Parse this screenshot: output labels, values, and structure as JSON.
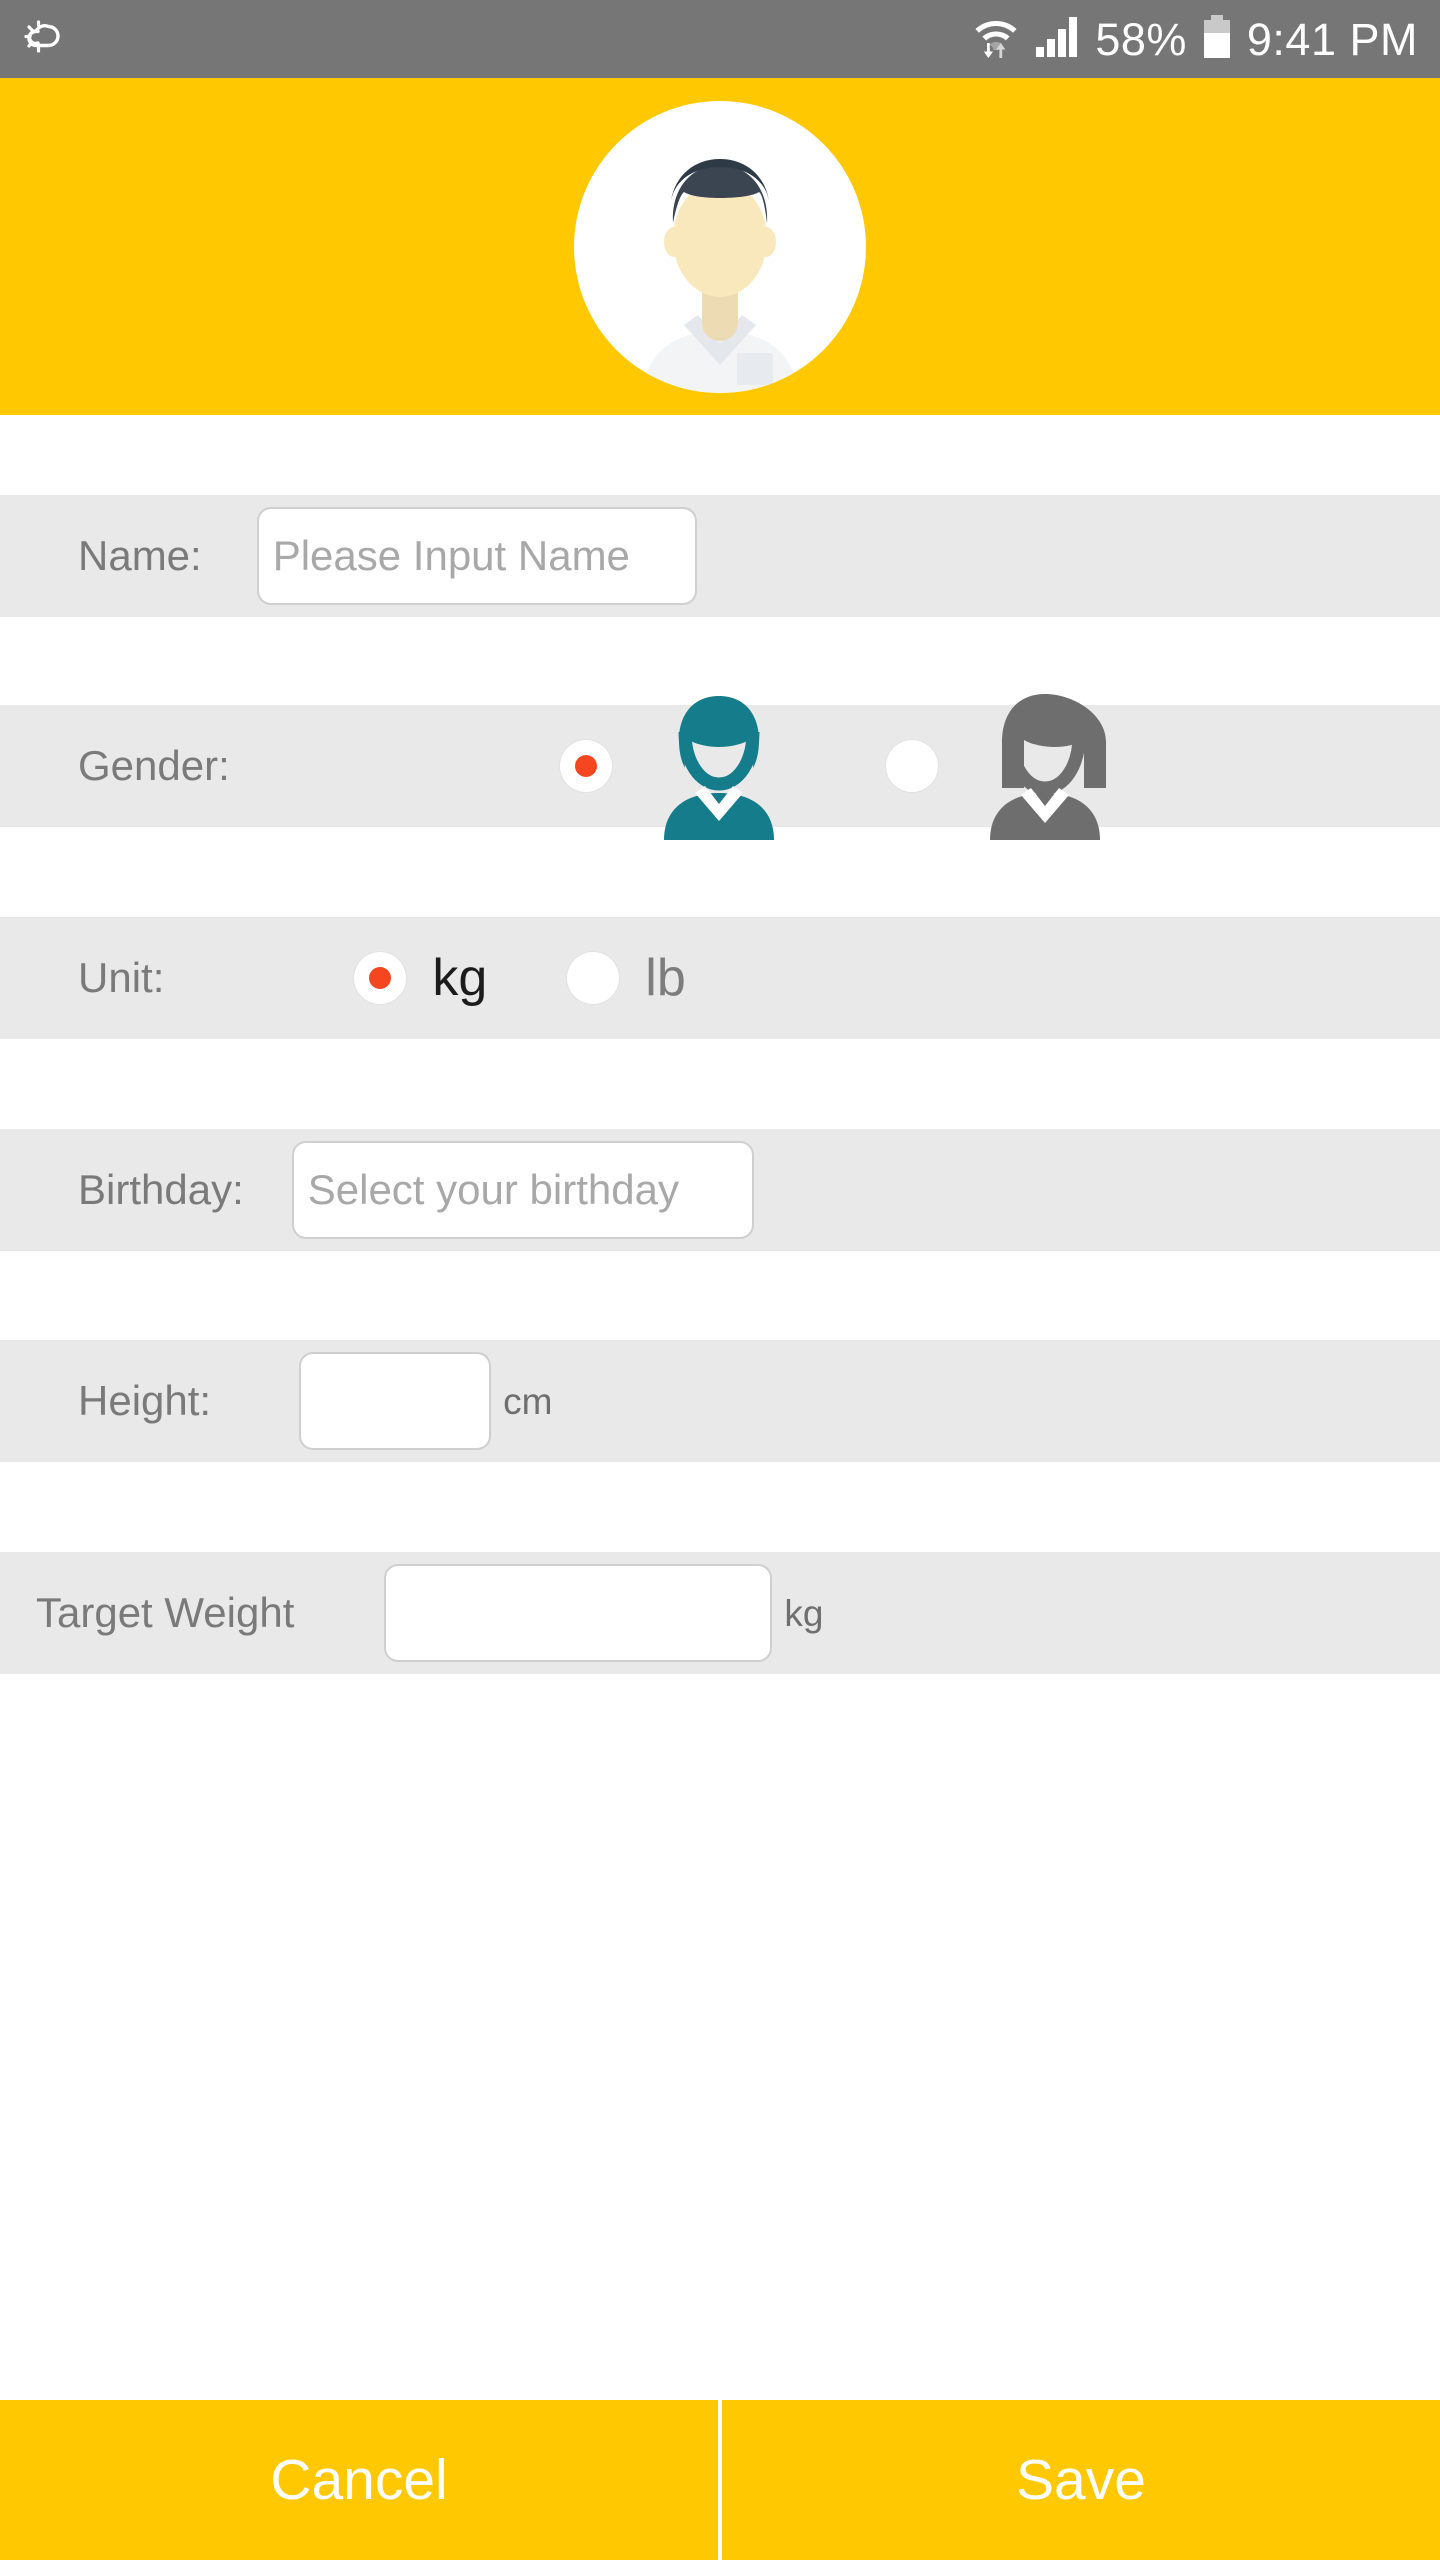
{
  "status_bar": {
    "left_icon": "weather-partly-cloudy-icon",
    "wifi_icon": "wifi-data-transfer-icon",
    "signal_icon": "cellular-signal-icon",
    "battery_percent": "58%",
    "battery_icon": "battery-icon",
    "time": "9:41 PM",
    "background_color": "#767676"
  },
  "header": {
    "avatar_icon": "user-avatar-photo",
    "background_color": "#ffc800"
  },
  "form": {
    "name": {
      "label": "Name:",
      "placeholder": "Please Input Name",
      "value": ""
    },
    "gender": {
      "label": "Gender:",
      "options": [
        {
          "key": "male",
          "icon": "male-figure-icon",
          "selected": true,
          "color": "#147c8a"
        },
        {
          "key": "female",
          "icon": "female-figure-icon",
          "selected": false,
          "color": "#6e6e6e"
        }
      ]
    },
    "unit": {
      "label": "Unit:",
      "options": [
        {
          "key": "kg",
          "label": "kg",
          "selected": true
        },
        {
          "key": "lb",
          "label": "lb",
          "selected": false
        }
      ]
    },
    "birthday": {
      "label": "Birthday:",
      "placeholder": "Select your birthday",
      "value": ""
    },
    "height": {
      "label": "Height:",
      "value": "",
      "unit": "cm"
    },
    "target_weight": {
      "label": "Target Weight",
      "value": "",
      "unit": "kg"
    },
    "row_background_color": "#e9e9e9",
    "label_color": "#7a7a7a",
    "radio_selected_color": "#f4461f"
  },
  "footer": {
    "cancel_label": "Cancel",
    "save_label": "Save",
    "background_color": "#ffc800",
    "text_color": "#ffffff"
  }
}
